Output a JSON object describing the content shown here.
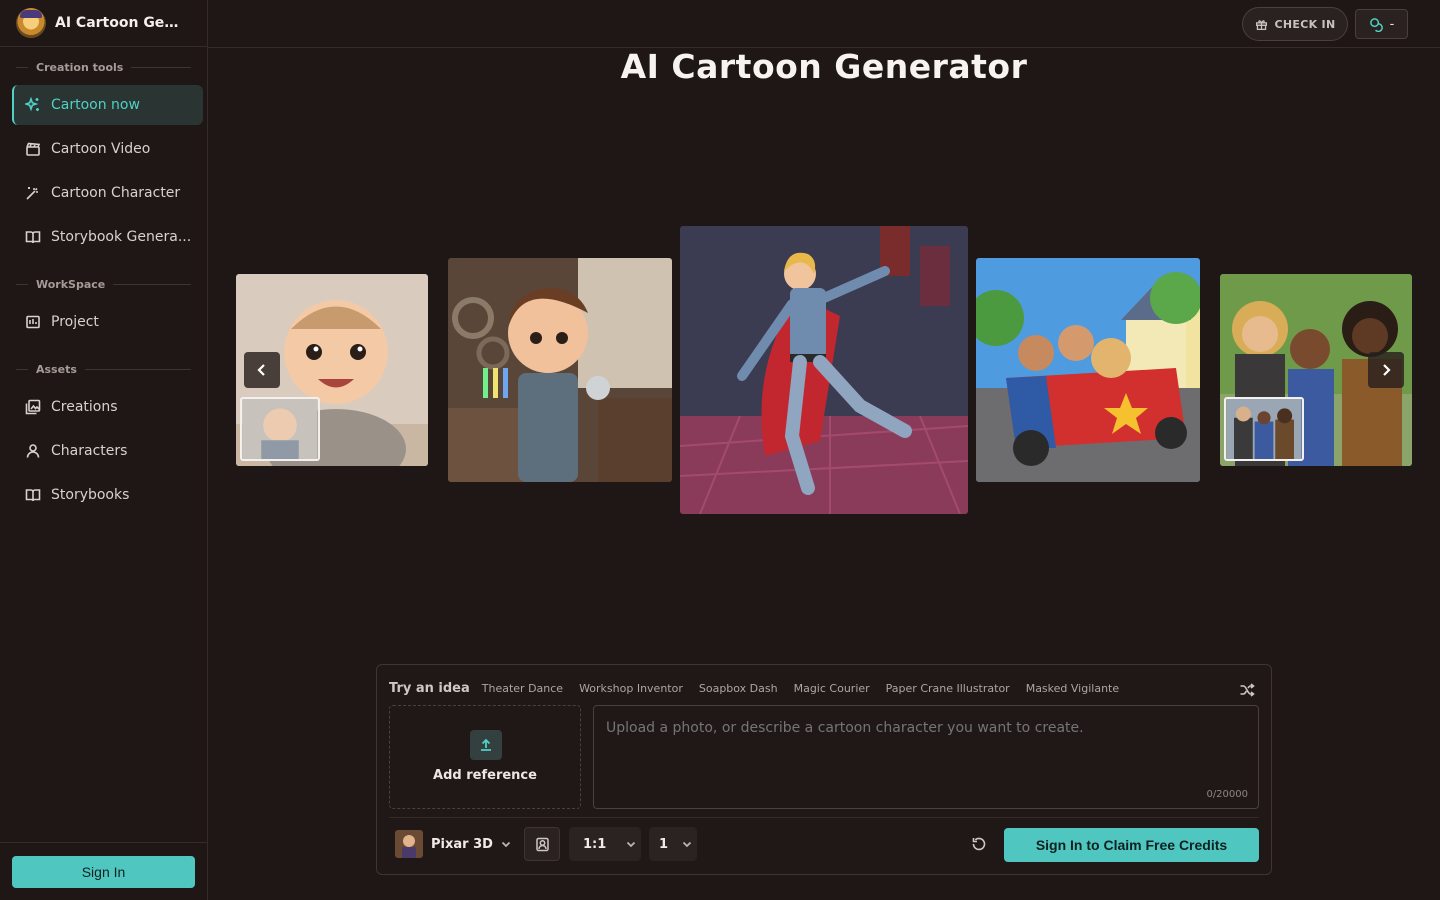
{
  "app": {
    "title": "AI Cartoon Generator",
    "brand_short": "AI Cartoon Gener..."
  },
  "sidebar": {
    "sections": [
      {
        "label": "Creation tools"
      },
      {
        "label": "WorkSpace"
      },
      {
        "label": "Assets"
      }
    ],
    "items": [
      {
        "label": "Cartoon now",
        "icon": "sparkle-icon",
        "active": true
      },
      {
        "label": "Cartoon Video",
        "icon": "clapperboard-icon"
      },
      {
        "label": "Cartoon Character",
        "icon": "magic-wand-icon"
      },
      {
        "label": "Storybook Genera...",
        "icon": "book-open-icon"
      },
      {
        "label": "Project",
        "icon": "folder-icon"
      },
      {
        "label": "Creations",
        "icon": "gallery-icon"
      },
      {
        "label": "Characters",
        "icon": "user-icon"
      },
      {
        "label": "Storybooks",
        "icon": "book-open-icon"
      }
    ],
    "sign_in": "Sign In"
  },
  "topbar": {
    "check_in": "CHECK IN",
    "credits": "-"
  },
  "hero": {
    "title": "AI Cartoon Generator"
  },
  "composer": {
    "ideas_label": "Try an idea",
    "ideas": [
      "Theater Dance",
      "Workshop Inventor",
      "Soapbox Dash",
      "Magic Courier",
      "Paper Crane Illustrator",
      "Masked Vigilante"
    ],
    "reference_label": "Add reference",
    "prompt_placeholder": "Upload a photo, or describe a cartoon character you want to create.",
    "char_count": "0/20000",
    "style": "Pixar 3D",
    "aspect_ratio": "1:1",
    "count": "1",
    "submit_label": "Sign In to Claim Free Credits"
  },
  "colors": {
    "accent": "#4fc7c0",
    "background": "#1e1716"
  }
}
